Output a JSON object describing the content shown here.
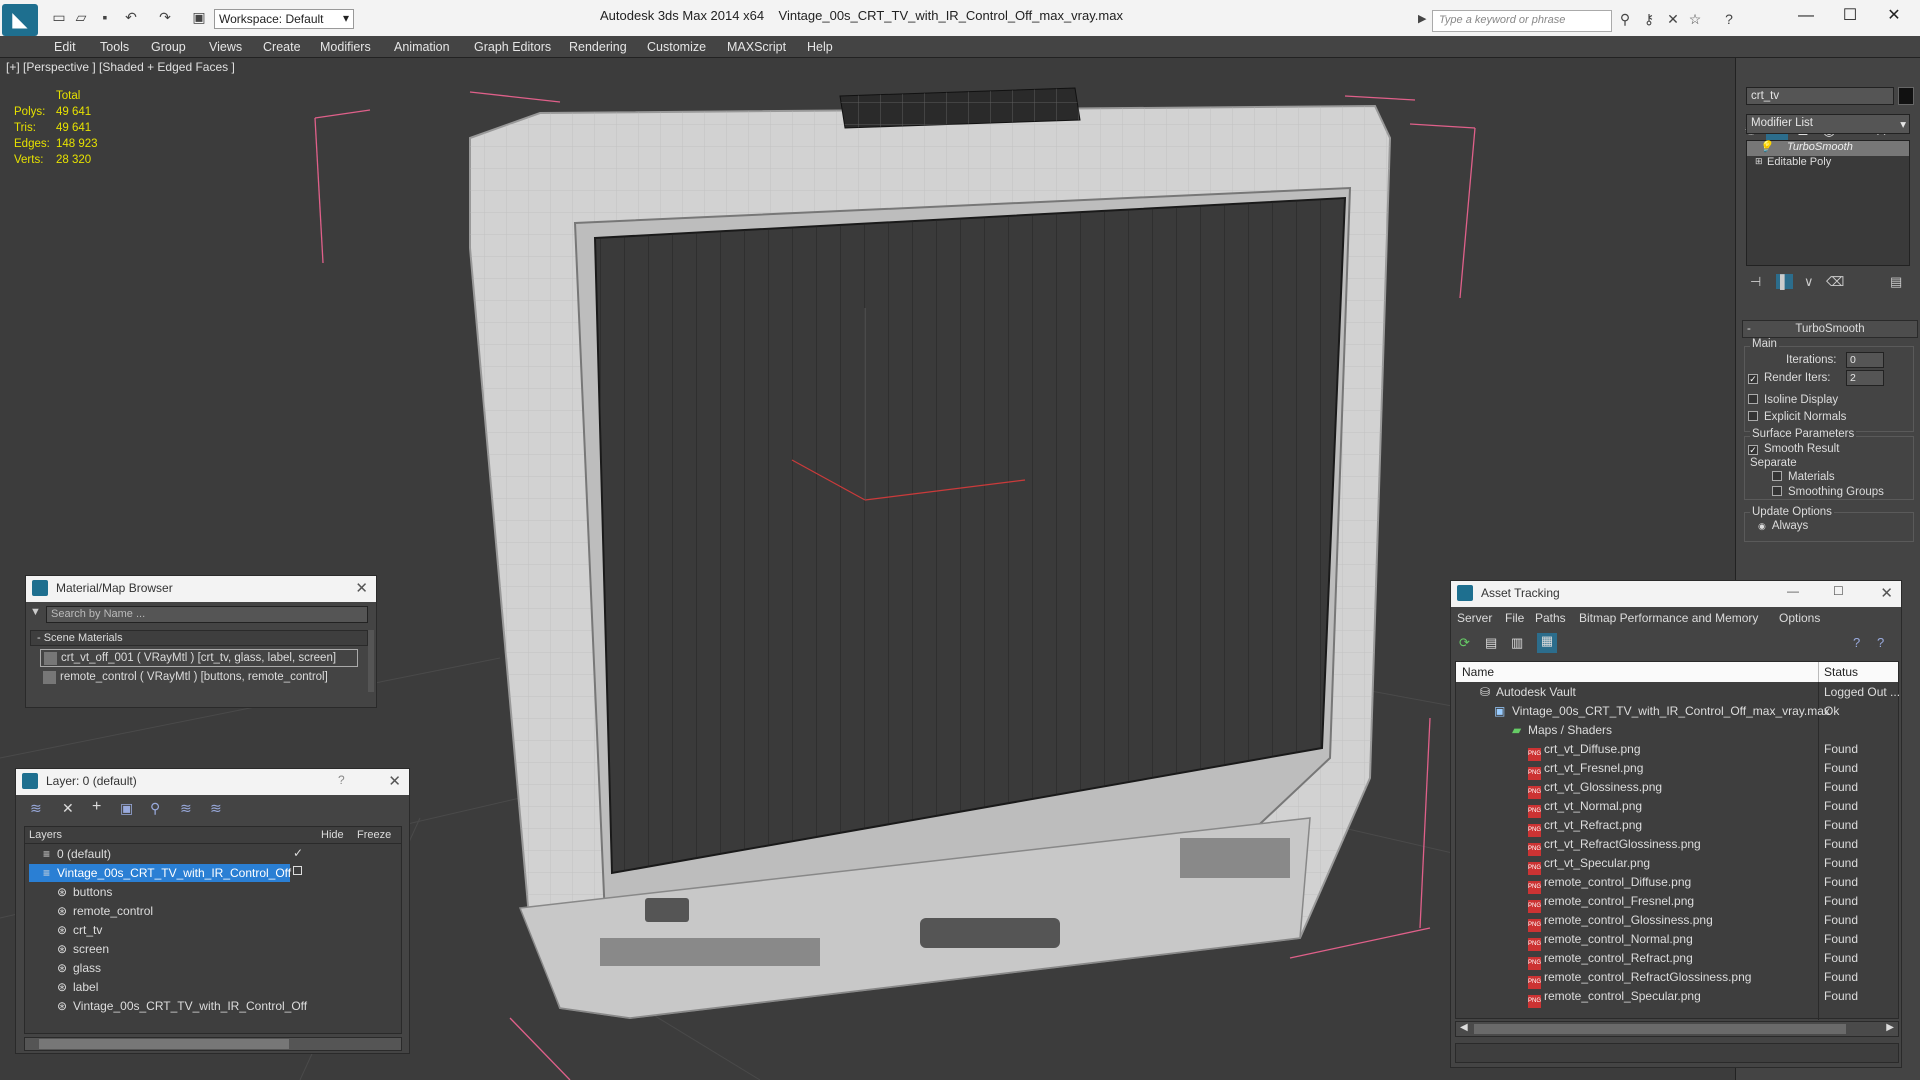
{
  "titlebar": {
    "app_title": "Autodesk 3ds Max  2014 x64",
    "file_title": "Vintage_00s_CRT_TV_with_IR_Control_Off_max_vray.max",
    "workspace": "Workspace: Default",
    "search_placeholder": "Type a keyword or phrase"
  },
  "menu": [
    "Edit",
    "Tools",
    "Group",
    "Views",
    "Create",
    "Modifiers",
    "Animation",
    "Graph Editors",
    "Rendering",
    "Customize",
    "MAXScript",
    "Help"
  ],
  "viewport": {
    "label": "[+] [Perspective ] [Shaded + Edged Faces ]",
    "stats": {
      "header": "Total",
      "rows": [
        {
          "label": "Polys:",
          "value": "49 641"
        },
        {
          "label": "Tris:",
          "value": "49 641"
        },
        {
          "label": "Edges:",
          "value": "148 923"
        },
        {
          "label": "Verts:",
          "value": "28 320"
        }
      ]
    }
  },
  "command_panel": {
    "object_name": "crt_tv",
    "modifier_list": "Modifier List",
    "stack": [
      "TurboSmooth",
      "Editable Poly"
    ],
    "rollout_title": "TurboSmooth",
    "main_label": "Main",
    "iterations_label": "Iterations:",
    "iterations_value": "0",
    "render_iters_label": "Render Iters:",
    "render_iters_value": "2",
    "isoline_label": "Isoline Display",
    "explicit_normals_label": "Explicit Normals",
    "surface_params_label": "Surface Parameters",
    "smooth_result_label": "Smooth Result",
    "separate_label": "Separate",
    "materials_label": "Materials",
    "smoothing_groups_label": "Smoothing Groups",
    "update_options_label": "Update Options",
    "always_label": "Always"
  },
  "material_browser": {
    "title": "Material/Map Browser",
    "search_placeholder": "Search by Name ...",
    "group": "- Scene Materials",
    "items": [
      "crt_vt_off_001  ( VRayMtl ) [crt_tv, glass, label, screen]",
      "remote_control  ( VRayMtl ) [buttons, remote_control]"
    ]
  },
  "layer_panel": {
    "title": "Layer: 0 (default)",
    "help": "?",
    "columns": [
      "Layers",
      "Hide",
      "Freeze"
    ],
    "rows": [
      "0 (default)",
      "Vintage_00s_CRT_TV_with_IR_Control_Off",
      "buttons",
      "remote_control",
      "crt_tv",
      "screen",
      "glass",
      "label",
      "Vintage_00s_CRT_TV_with_IR_Control_Off"
    ]
  },
  "asset_tracking": {
    "title": "Asset Tracking",
    "menu": [
      "Server",
      "File",
      "Paths",
      "Bitmap Performance and Memory",
      "Options"
    ],
    "columns": [
      "Name",
      "Status"
    ],
    "rows": [
      {
        "name": "Autodesk Vault",
        "status": "Logged Out ..."
      },
      {
        "name": "Vintage_00s_CRT_TV_with_IR_Control_Off_max_vray.max",
        "status": "Ok"
      },
      {
        "name": "Maps / Shaders",
        "status": ""
      },
      {
        "name": "crt_vt_Diffuse.png",
        "status": "Found"
      },
      {
        "name": "crt_vt_Fresnel.png",
        "status": "Found"
      },
      {
        "name": "crt_vt_Glossiness.png",
        "status": "Found"
      },
      {
        "name": "crt_vt_Normal.png",
        "status": "Found"
      },
      {
        "name": "crt_vt_Refract.png",
        "status": "Found"
      },
      {
        "name": "crt_vt_RefractGlossiness.png",
        "status": "Found"
      },
      {
        "name": "crt_vt_Specular.png",
        "status": "Found"
      },
      {
        "name": "remote_control_Diffuse.png",
        "status": "Found"
      },
      {
        "name": "remote_control_Fresnel.png",
        "status": "Found"
      },
      {
        "name": "remote_control_Glossiness.png",
        "status": "Found"
      },
      {
        "name": "remote_control_Normal.png",
        "status": "Found"
      },
      {
        "name": "remote_control_Refract.png",
        "status": "Found"
      },
      {
        "name": "remote_control_RefractGlossiness.png",
        "status": "Found"
      },
      {
        "name": "remote_control_Specular.png",
        "status": "Found"
      }
    ]
  }
}
